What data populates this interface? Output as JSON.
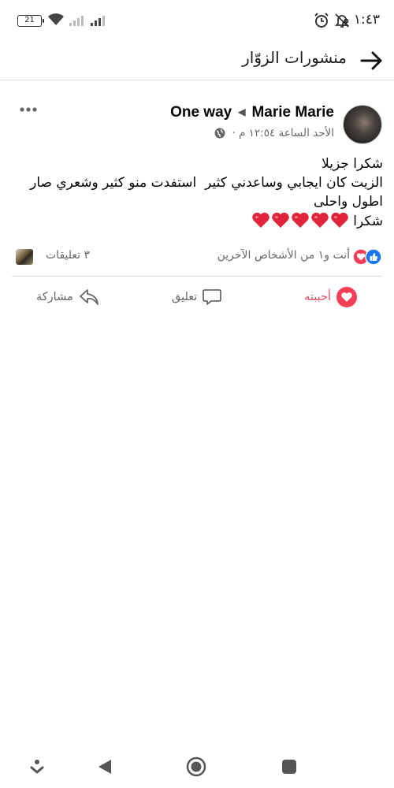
{
  "status_bar": {
    "battery_level": "21",
    "time": "١:٤٣ م"
  },
  "header": {
    "title": "منشورات الزوّار"
  },
  "post": {
    "author_name": "Marie Marie",
    "page_name": "One way",
    "meta": "الأحد الساعة ١٢:٥٤ م ·",
    "text_lines": [
      "شكرا جزيلا",
      "الزيت كان ايجابي وساعدني كثير  استفدت منو كثير وشعري صار اطول واحلى",
      "شكرا"
    ],
    "hearts_count": 5,
    "reaction_summary": "أنت و١ من الأشخاص الآخرين",
    "comments_count": "٣ تعليقات"
  },
  "actions": {
    "like_label": "أحببته",
    "comment_label": "تعليق",
    "share_label": "مشاركة"
  },
  "colors": {
    "love": "#e34b63",
    "like_blue": "#1877f2",
    "muted_text": "#65676b"
  },
  "icons": [
    "battery-icon",
    "wifi-icon",
    "signal-icon",
    "alarm-icon",
    "bell-off-icon",
    "back-arrow-icon",
    "more-icon",
    "globe-icon",
    "heart-icon",
    "like-icon",
    "comment-icon",
    "share-icon",
    "nav-menu-icon",
    "nav-back-icon",
    "nav-home-icon",
    "nav-recents-icon"
  ]
}
